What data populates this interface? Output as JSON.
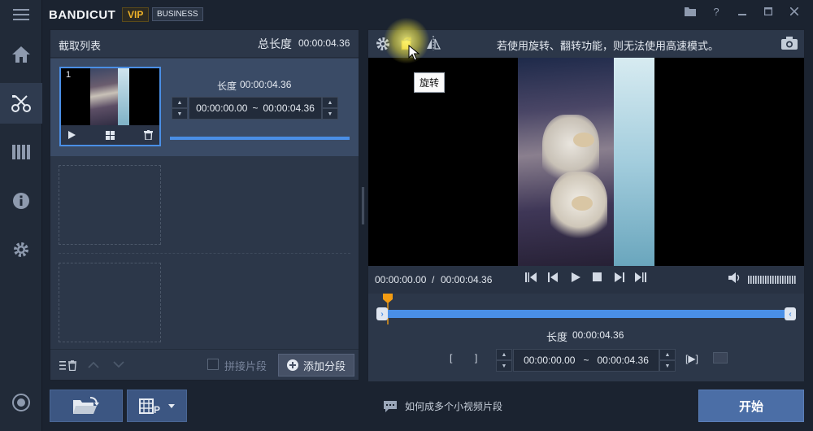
{
  "app": {
    "brand": "BANDICUT",
    "vip_badge": "VIP",
    "edition_badge": "BUSINESS"
  },
  "left_panel": {
    "title": "截取列表",
    "total_length_label": "总长度",
    "total_length_value": "00:00:04.36",
    "clip": {
      "index": "1",
      "length_label": "长度",
      "length_value": "00:00:04.36",
      "range_start": "00:00:00.00",
      "range_sep": "~",
      "range_end": "00:00:04.36"
    },
    "footer": {
      "join_checkbox_label": "拼接片段",
      "add_segment_label": "添加分段"
    }
  },
  "right_panel": {
    "notice": "若使用旋转、翻转功能，则无法使用高速模式。",
    "tooltip": "旋转",
    "time_current": "00:00:00.00",
    "time_sep": "/",
    "time_total": "00:00:04.36",
    "length_label": "长度",
    "length_value": "00:00:04.36",
    "range_start": "00:00:00.00",
    "range_sep": "~",
    "range_end": "00:00:04.36",
    "volume_level": 1.0
  },
  "bottom": {
    "hint": "如何成多个小视频片段",
    "start_label": "开始"
  },
  "colors": {
    "accent": "#4a8fe6",
    "vip": "#f0b429",
    "marker": "#f39c12"
  }
}
